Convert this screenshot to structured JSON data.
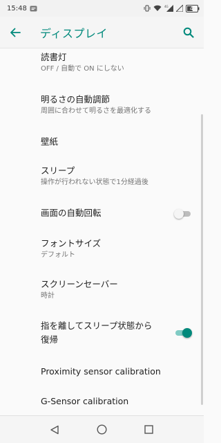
{
  "status_bar": {
    "time": "15:48",
    "battery_level": "47"
  },
  "app_bar": {
    "title": "ディスプレイ",
    "accent_color": "#00897b"
  },
  "settings": [
    {
      "title": "読書灯",
      "summary": "OFF / 自動で ON にしない"
    },
    {
      "title": "明るさの自動調節",
      "summary": "周囲に合わせて明るさを最適化する"
    },
    {
      "title": "壁紙",
      "summary": ""
    },
    {
      "title": "スリープ",
      "summary": "操作が行われない状態で1分経過後"
    },
    {
      "title": "画面の自動回転",
      "summary": "",
      "toggle": "off"
    },
    {
      "title": "フォントサイズ",
      "summary": "デフォルト"
    },
    {
      "title": "スクリーンセーバー",
      "summary": "時計"
    },
    {
      "title": "指を離してスリープ状態から",
      "title_line2": "復帰",
      "summary": "",
      "toggle": "on"
    },
    {
      "title": "Proximity sensor calibration",
      "summary": ""
    },
    {
      "title": "G-Sensor calibration",
      "summary": ""
    }
  ],
  "nav_bar": {
    "icons": [
      "back-triangle-icon",
      "home-circle-icon",
      "recents-square-icon"
    ]
  }
}
